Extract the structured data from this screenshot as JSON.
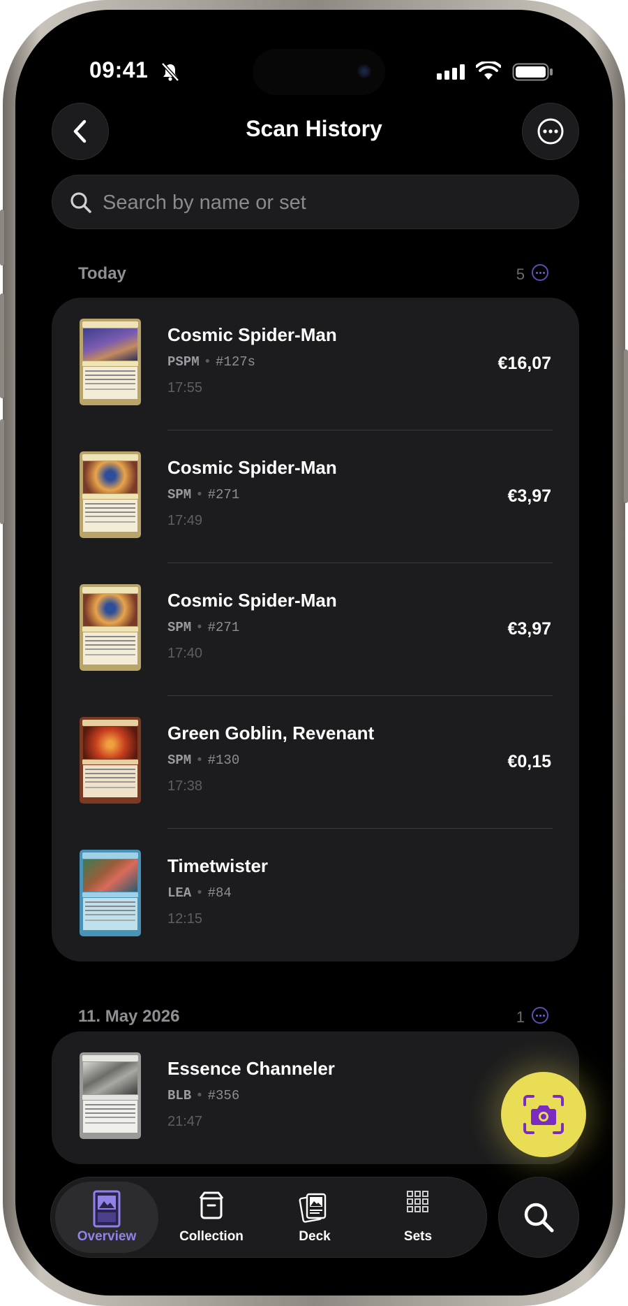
{
  "status_bar": {
    "time": "09:41",
    "icons": [
      "bell-slash-icon",
      "signal-icon",
      "wifi-icon",
      "battery-icon"
    ]
  },
  "header": {
    "title": "Scan History",
    "back_icon": "chevron-left-icon",
    "more_icon": "ellipsis-circle-icon"
  },
  "search": {
    "placeholder": "Search by name or set",
    "value": ""
  },
  "sections": [
    {
      "title": "Today",
      "count": "5",
      "items": [
        {
          "name": "Cosmic Spider-Man",
          "set": "PSPM",
          "number": "#127s",
          "time": "17:55",
          "price": "€16,07"
        },
        {
          "name": "Cosmic Spider-Man",
          "set": "SPM",
          "number": "#271",
          "time": "17:49",
          "price": "€3,97"
        },
        {
          "name": "Cosmic Spider-Man",
          "set": "SPM",
          "number": "#271",
          "time": "17:40",
          "price": "€3,97"
        },
        {
          "name": "Green Goblin, Revenant",
          "set": "SPM",
          "number": "#130",
          "time": "17:38",
          "price": "€0,15"
        },
        {
          "name": "Timetwister",
          "set": "LEA",
          "number": "#84",
          "time": "12:15",
          "price": ""
        }
      ]
    },
    {
      "title": "11. May 2026",
      "count": "1",
      "items": [
        {
          "name": "Essence Channeler",
          "set": "BLB",
          "number": "#356",
          "time": "21:47",
          "price": ""
        }
      ]
    }
  ],
  "meta_separator": "•",
  "fab": {
    "icon": "camera-scan-icon"
  },
  "tabs": [
    {
      "label": "Overview",
      "icon": "card-icon",
      "active": true
    },
    {
      "label": "Collection",
      "icon": "box-icon",
      "active": false
    },
    {
      "label": "Deck",
      "icon": "cards-stack-icon",
      "active": false
    },
    {
      "label": "Sets",
      "icon": "grid-icon",
      "active": false
    }
  ],
  "search_tab": {
    "icon": "magnifier-icon"
  },
  "colors": {
    "background": "#000000",
    "card": "#1c1c1e",
    "accent": "#8f83e8",
    "fab": "#e9dd55"
  }
}
